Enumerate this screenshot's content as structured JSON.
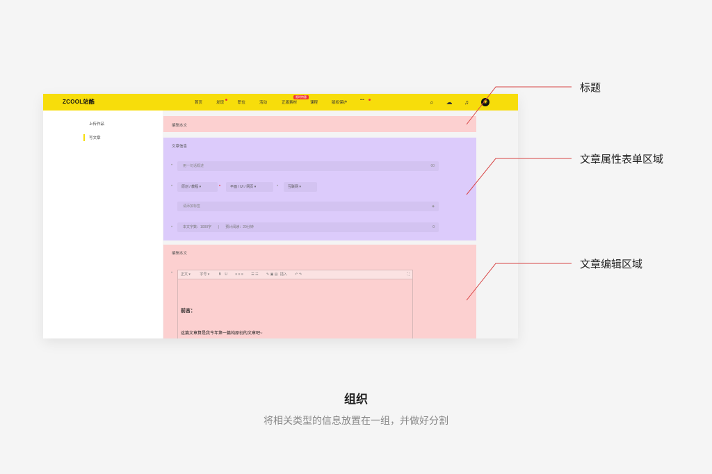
{
  "topbar": {
    "logo": "ZCOOL站酷",
    "nav": [
      "首页",
      "发现",
      "职位",
      "活动",
      "正版素材",
      "课程",
      "版权保护",
      "•••"
    ],
    "badge": "限时特惠",
    "colors": {
      "brand": "#f7dd0b",
      "accent": "#e33333"
    },
    "icons": [
      "search-icon",
      "cloud-upload-icon",
      "bell-icon",
      "avatar"
    ]
  },
  "sidebar": {
    "items": [
      {
        "label": "上传作品"
      },
      {
        "label": "写文章"
      }
    ]
  },
  "title_panel": {
    "label": "编辑本文"
  },
  "info_panel": {
    "title": "文章信息",
    "summary_placeholder": "用一句话概述",
    "summary_count": "00",
    "selects": [
      "原创 / 教程",
      "平面 / UI / 网页",
      "互联网"
    ],
    "tags_placeholder": "请添加标签",
    "word_count": "本文字数：1000字",
    "read_time": "预计阅读：20分钟",
    "read_count": "0"
  },
  "editor_panel": {
    "title": "编辑本文",
    "toolbar_font": "正文",
    "toolbar_size": "字号",
    "toolbar_insert": "插入",
    "heading": "前言：",
    "body": "这篇文章算是我今年第一篇纯原创的文章吧~"
  },
  "annotations": {
    "title": "标题",
    "form_area": "文章属性表单区域",
    "editor_area": "文章编辑区域"
  },
  "footer": {
    "title": "组织",
    "subtitle": "将相关类型的信息放置在一组，并做好分割"
  }
}
